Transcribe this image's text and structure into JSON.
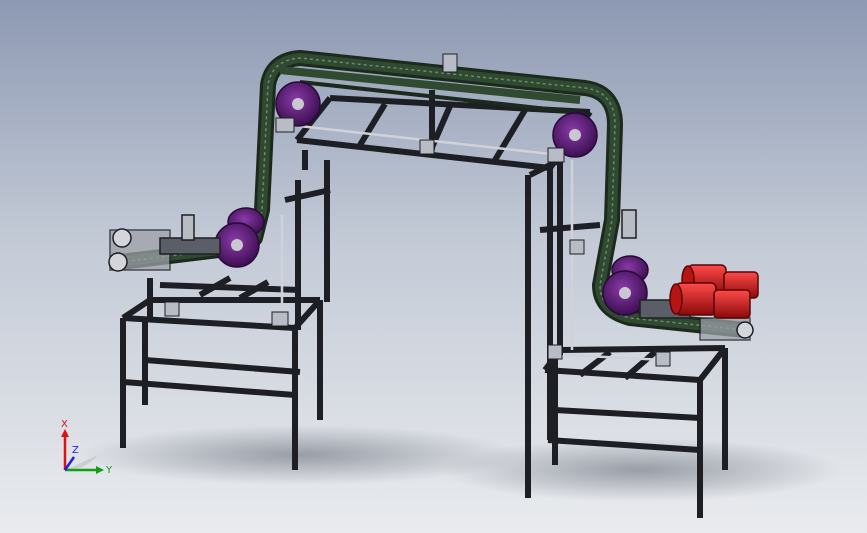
{
  "viewport": {
    "background_top": "#8d99b3",
    "background_bottom": "#e9ebee"
  },
  "colors": {
    "frame": "#1e1f24",
    "frame_highlight": "#4d5058",
    "belt": "#2f4a30",
    "belt_edge": "#1b2a1c",
    "pulley": "#6a1f86",
    "pulley_hub": "#c9c7cf",
    "motor": "#d61f1f",
    "rod": "#cfd2d8",
    "shadow": "#6f7580"
  },
  "triad": {
    "x_label": "X",
    "y_label": "Y",
    "z_label": "Z",
    "x_color": "#e01010",
    "y_color": "#10a010",
    "z_color": "#2020e0"
  },
  "model": {
    "name": "conveyor-assembly",
    "pulleys": 8,
    "motors": 2
  }
}
